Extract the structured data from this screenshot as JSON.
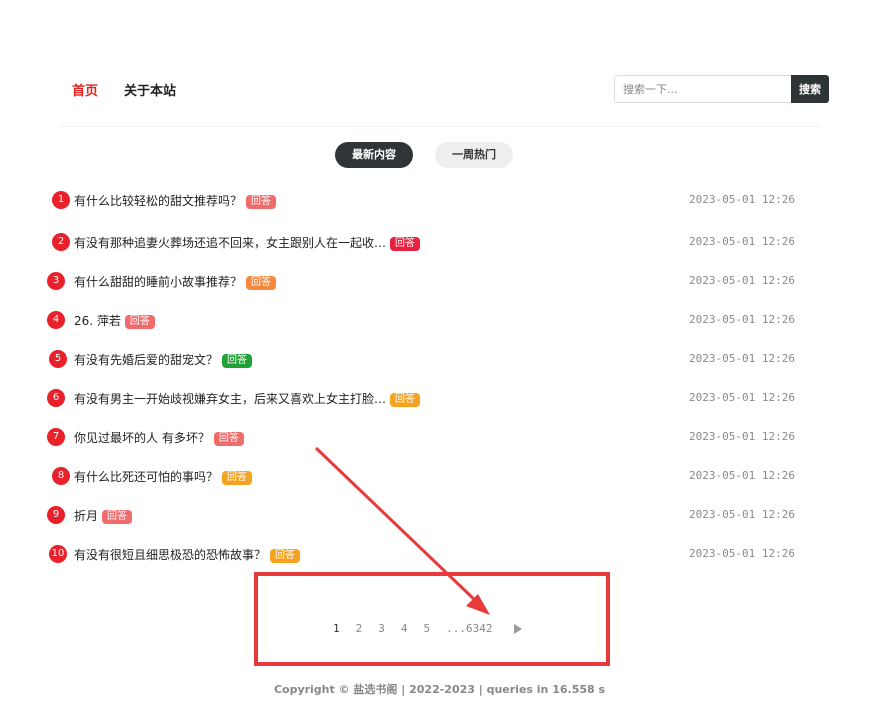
{
  "nav": {
    "items": [
      {
        "label": "首页",
        "active": true
      },
      {
        "label": "关于本站",
        "active": false
      }
    ]
  },
  "search": {
    "placeholder": "搜索一下...",
    "button_label": "搜索"
  },
  "tabs": [
    {
      "label": "最新内容",
      "active": true
    },
    {
      "label": "一周热门",
      "active": false
    }
  ],
  "posts": [
    {
      "rank": "1",
      "title": "有什么比较轻松的甜文推荐吗？",
      "badge": "回答",
      "badge_color": "#f06b6b",
      "time": "2023-05-01 12:26"
    },
    {
      "rank": "2",
      "title": "有没有那种追妻火葬场还追不回来，女主跟别人在一起收…",
      "badge": "回答",
      "badge_color": "#e8213f",
      "time": "2023-05-01 12:26"
    },
    {
      "rank": "3",
      "title": "有什么甜甜的睡前小故事推荐？",
      "badge": "回答",
      "badge_color": "#f5883a",
      "time": "2023-05-01 12:26"
    },
    {
      "rank": "4",
      "title": "26. 萍若",
      "badge": "回答",
      "badge_color": "#f06b6b",
      "time": "2023-05-01 12:26"
    },
    {
      "rank": "5",
      "title": "有没有先婚后爱的甜宠文？",
      "badge": "回答",
      "badge_color": "#22a136",
      "time": "2023-05-01 12:26"
    },
    {
      "rank": "6",
      "title": "有没有男主一开始歧视嫌弃女主，后来又喜欢上女主打脸…",
      "badge": "回答",
      "badge_color": "#f5a21f",
      "time": "2023-05-01 12:26"
    },
    {
      "rank": "7",
      "title": "你见过最坏的人 有多坏？",
      "badge": "回答",
      "badge_color": "#f06b6b",
      "time": "2023-05-01 12:26"
    },
    {
      "rank": "8",
      "title": "有什么比死还可怕的事吗？",
      "badge": "回答",
      "badge_color": "#f5a21f",
      "time": "2023-05-01 12:26"
    },
    {
      "rank": "9",
      "title": "折月",
      "badge": "回答",
      "badge_color": "#f06b6b",
      "time": "2023-05-01 12:26"
    },
    {
      "rank": "10",
      "title": "有没有很短且细思极恐的恐怖故事？",
      "badge": "回答",
      "badge_color": "#f5a21f",
      "time": "2023-05-01 12:26"
    }
  ],
  "pagination": {
    "pages": [
      "1",
      "2",
      "3",
      "4",
      "5"
    ],
    "current": "1",
    "last": "...6342",
    "next_icon": "play-triangle-icon"
  },
  "annotation": {
    "color": "#e83a3a"
  },
  "footer": {
    "text": "Copyright © 盐选书阁 | 2022-2023 | queries in 16.558 s"
  }
}
